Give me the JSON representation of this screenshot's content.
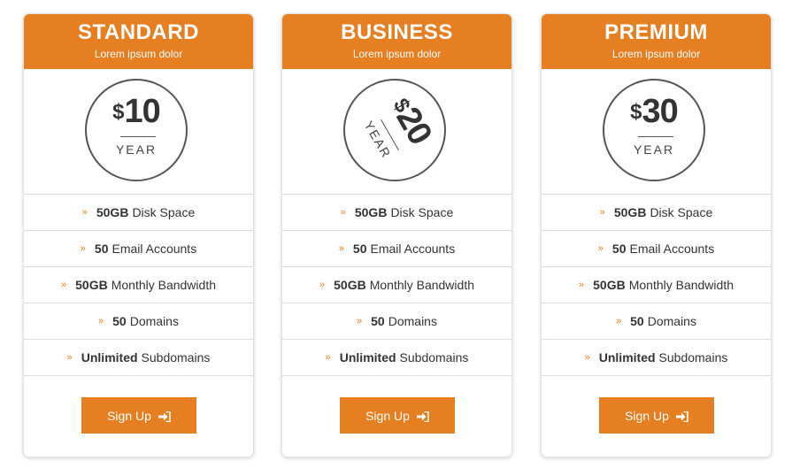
{
  "plans": [
    {
      "name": "STANDARD",
      "subtitle": "Lorem ipsum dolor",
      "currency": "$",
      "price": "10",
      "period": "YEAR",
      "features": [
        {
          "strong": "50GB",
          "text": "Disk Space"
        },
        {
          "strong": "50",
          "text": "Email Accounts"
        },
        {
          "strong": "50GB",
          "text": "Monthly Bandwidth"
        },
        {
          "strong": "50",
          "text": "Domains"
        },
        {
          "strong": "Unlimited",
          "text": "Subdomains"
        }
      ],
      "button": "Sign Up"
    },
    {
      "name": "BUSINESS",
      "subtitle": "Lorem ipsum dolor",
      "currency": "$",
      "price": "20",
      "period": "YEAR",
      "features": [
        {
          "strong": "50GB",
          "text": "Disk Space"
        },
        {
          "strong": "50",
          "text": "Email Accounts"
        },
        {
          "strong": "50GB",
          "text": "Monthly Bandwidth"
        },
        {
          "strong": "50",
          "text": "Domains"
        },
        {
          "strong": "Unlimited",
          "text": "Subdomains"
        }
      ],
      "button": "Sign Up"
    },
    {
      "name": "PREMIUM",
      "subtitle": "Lorem ipsum dolor",
      "currency": "$",
      "price": "30",
      "period": "YEAR",
      "features": [
        {
          "strong": "50GB",
          "text": "Disk Space"
        },
        {
          "strong": "50",
          "text": "Email Accounts"
        },
        {
          "strong": "50GB",
          "text": "Monthly Bandwidth"
        },
        {
          "strong": "50",
          "text": "Domains"
        },
        {
          "strong": "Unlimited",
          "text": "Subdomains"
        }
      ],
      "button": "Sign Up"
    }
  ],
  "colors": {
    "accent": "#e67e22",
    "border": "#dcdcdc",
    "text": "#333333"
  },
  "icons": {
    "feature_bullet": "double-chevron-right-icon",
    "button": "sign-in-icon"
  }
}
